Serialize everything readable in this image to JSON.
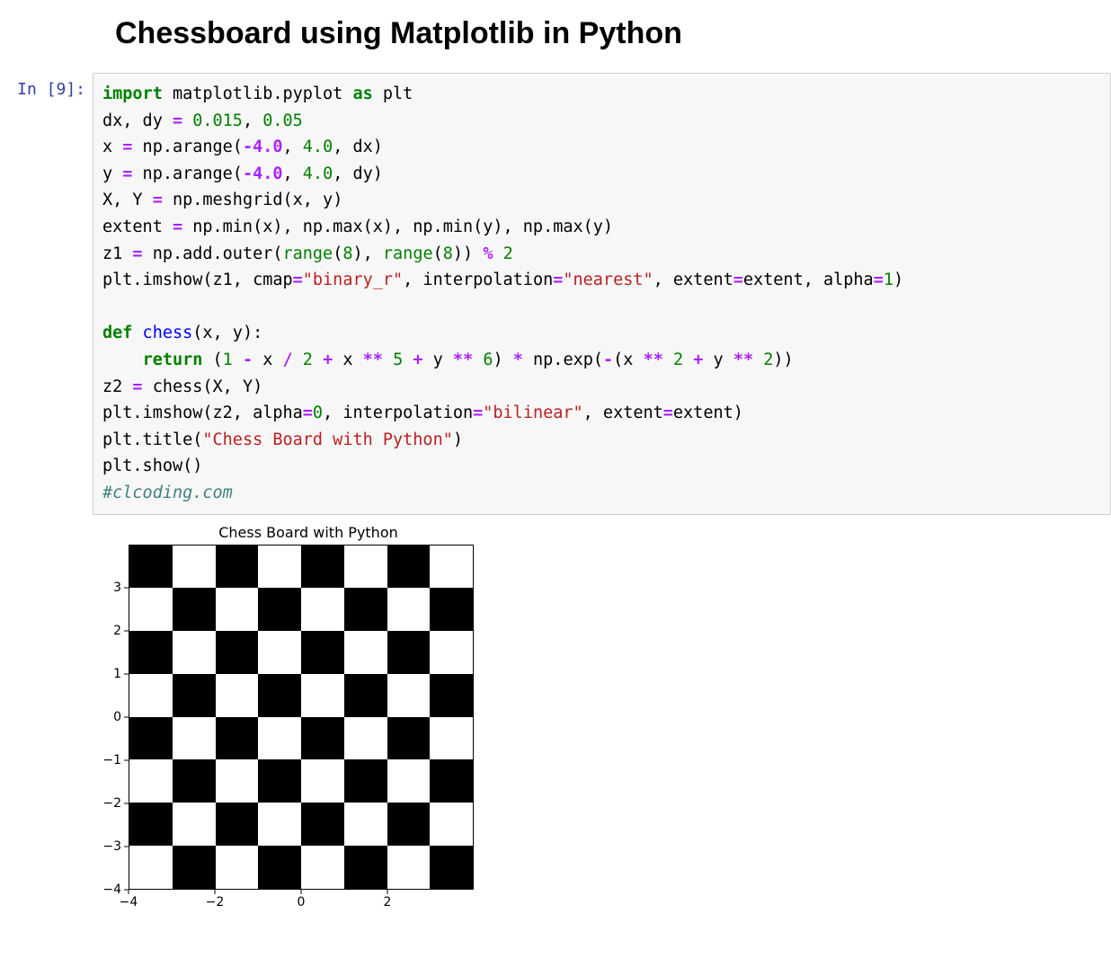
{
  "title": "Chessboard using Matplotlib in Python",
  "prompt": "In [9]:",
  "code": {
    "l1_import": "import",
    "l1_pkg": " matplotlib.pyplot ",
    "l1_as": "as",
    "l1_alias": " plt",
    "l2_a": "dx, dy ",
    "l2_eq": "=",
    "l2_b": " ",
    "l2_n1": "0.015",
    "l2_c": ", ",
    "l2_n2": "0.05",
    "l3_a": "x ",
    "l3_eq": "=",
    "l3_b": " np.arange(",
    "l3_n1": "-4.0",
    "l3_c": ", ",
    "l3_n2": "4.0",
    "l3_d": ", dx)",
    "l4_a": "y ",
    "l4_eq": "=",
    "l4_b": " np.arange(",
    "l4_n1": "-4.0",
    "l4_c": ", ",
    "l4_n2": "4.0",
    "l4_d": ", dy)",
    "l5_a": "X, Y ",
    "l5_eq": "=",
    "l5_b": " np.meshgrid(x, y)",
    "l6_a": "extent ",
    "l6_eq": "=",
    "l6_b": " np.min(x), np.max(x), np.min(y), np.max(y)",
    "l7_a": "z1 ",
    "l7_eq": "=",
    "l7_b": " np.add.outer(",
    "l7_range1": "range",
    "l7_c": "(",
    "l7_n1": "8",
    "l7_d": "), ",
    "l7_range2": "range",
    "l7_e": "(",
    "l7_n2": "8",
    "l7_f": ")) ",
    "l7_mod": "%",
    "l7_g": " ",
    "l7_n3": "2",
    "l8_a": "plt.imshow(z1, cmap",
    "l8_eq1": "=",
    "l8_s1": "\"binary_r\"",
    "l8_b": ", interpolation",
    "l8_eq2": "=",
    "l8_s2": "\"nearest\"",
    "l8_c": ", extent",
    "l8_eq3": "=",
    "l8_d": "extent, alpha",
    "l8_eq4": "=",
    "l8_n1": "1",
    "l8_e": ")",
    "l9_def": "def",
    "l9_name": " chess",
    "l9_sig": "(x, y):",
    "l10_ind": "    ",
    "l10_ret": "return",
    "l10_a": " (",
    "l10_n1": "1",
    "l10_b": " ",
    "l10_minus": "-",
    "l10_c": " x ",
    "l10_div": "/",
    "l10_d": " ",
    "l10_n2": "2",
    "l10_e": " ",
    "l10_plus1": "+",
    "l10_f": " x ",
    "l10_pow1": "**",
    "l10_g": " ",
    "l10_n3": "5",
    "l10_h": " ",
    "l10_plus2": "+",
    "l10_i": " y ",
    "l10_pow2": "**",
    "l10_j": " ",
    "l10_n4": "6",
    "l10_k": ") ",
    "l10_mul": "*",
    "l10_l": " np.exp(",
    "l10_neg": "-",
    "l10_m": "(x ",
    "l10_pow3": "**",
    "l10_n": " ",
    "l10_n5": "2",
    "l10_o": " ",
    "l10_plus3": "+",
    "l10_p": " y ",
    "l10_pow4": "**",
    "l10_q": " ",
    "l10_n6": "2",
    "l10_r": "))",
    "l11_a": "z2 ",
    "l11_eq": "=",
    "l11_b": " chess(X, Y)",
    "l12_a": "plt.imshow(z2, alpha",
    "l12_eq1": "=",
    "l12_n1": "0",
    "l12_b": ", interpolation",
    "l12_eq2": "=",
    "l12_s1": "\"bilinear\"",
    "l12_c": ", extent",
    "l12_eq3": "=",
    "l12_d": "extent)",
    "l13_a": "plt.title(",
    "l13_s": "\"Chess Board with Python\"",
    "l13_b": ")",
    "l14": "plt.show()",
    "l15": "#clcoding.com"
  },
  "chart_data": {
    "type": "heatmap",
    "title": "Chess Board with Python",
    "xlabel": "",
    "ylabel": "",
    "x_ticks": [
      -4,
      -2,
      0,
      2
    ],
    "y_ticks": [
      -4,
      -3,
      -2,
      -1,
      0,
      1,
      2,
      3
    ],
    "xlim": [
      -4,
      4
    ],
    "ylim": [
      -4,
      4
    ],
    "grid_size": 8,
    "pattern": "alternating black/white chessboard (value = (row+col) % 2, cmap binary_r)"
  }
}
